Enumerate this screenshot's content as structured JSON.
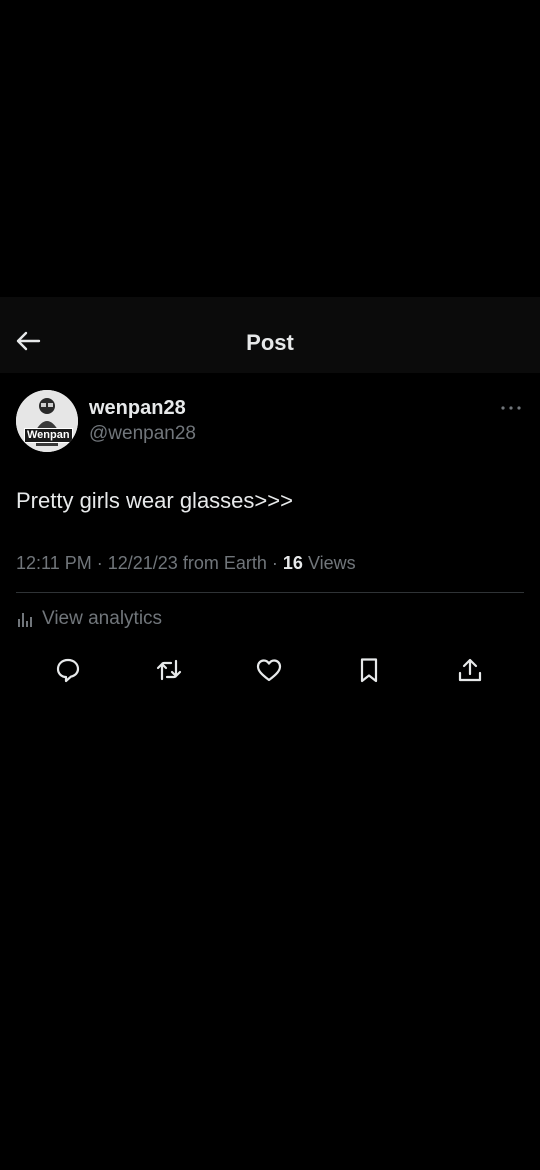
{
  "header": {
    "title": "Post",
    "back_icon": "arrow-left-icon"
  },
  "post": {
    "author": {
      "display_name": "wenpan28",
      "handle": "@wenpan28",
      "avatar_text": "Wenpan"
    },
    "text": "Pretty girls wear glasses>>>",
    "time": "12:11 PM",
    "date": "12/21/23",
    "source": "from Earth",
    "separator": "·",
    "views_count": "16",
    "views_label": "Views"
  },
  "analytics": {
    "label": "View analytics",
    "icon": "bar-chart-icon"
  },
  "actions": [
    {
      "name": "reply",
      "icon": "reply-icon"
    },
    {
      "name": "repost",
      "icon": "repost-icon"
    },
    {
      "name": "like",
      "icon": "heart-icon"
    },
    {
      "name": "bookmark",
      "icon": "bookmark-icon"
    },
    {
      "name": "share",
      "icon": "share-icon"
    }
  ],
  "colors": {
    "background": "#000000",
    "header_bg": "#0b0b0b",
    "primary_text": "#e7e9ea",
    "secondary_text": "#71767b",
    "divider": "#2f3336"
  }
}
